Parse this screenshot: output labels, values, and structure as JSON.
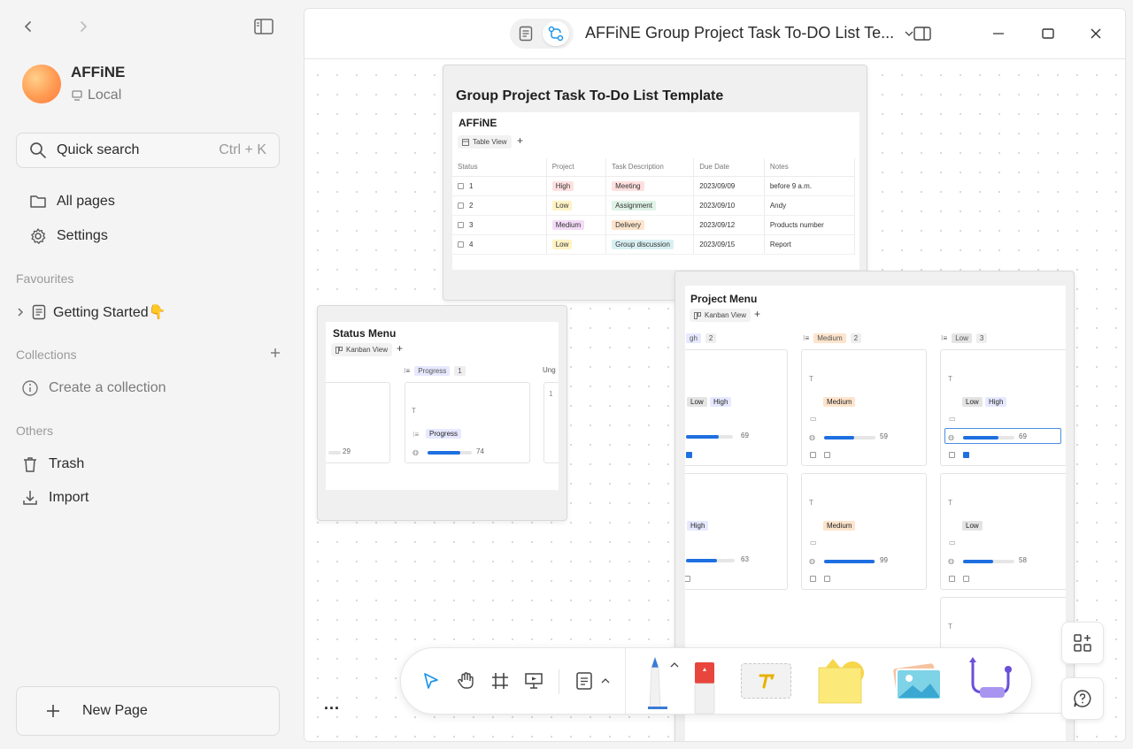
{
  "sidebar": {
    "workspace": {
      "name": "AFFiNE",
      "type": "Local"
    },
    "search": {
      "label": "Quick search",
      "shortcut": "Ctrl + K"
    },
    "nav": {
      "all_pages": "All pages",
      "settings": "Settings"
    },
    "favourites": {
      "title": "Favourites",
      "items": [
        {
          "label": "Getting Started👇"
        }
      ]
    },
    "collections": {
      "title": "Collections",
      "create_label": "Create a collection"
    },
    "others": {
      "title": "Others",
      "trash": "Trash",
      "import": "Import"
    },
    "new_page": "New Page"
  },
  "titlebar": {
    "title": "AFFiNE Group Project Task To-DO List Te..."
  },
  "canvas": {
    "main_card": {
      "title": "Group Project Task To-Do List Template",
      "db_title": "AFFiNE",
      "view": "Table View",
      "columns": [
        "Status",
        "Project",
        "Task Description",
        "Due Date",
        "Notes"
      ],
      "rows": [
        {
          "status": "1",
          "project": "High",
          "task": "Meeting",
          "due": "2023/09/09",
          "notes": "before 9 a.m."
        },
        {
          "status": "2",
          "project": "Low",
          "task": "Assignment",
          "due": "2023/09/10",
          "notes": "Andy"
        },
        {
          "status": "3",
          "project": "Medium",
          "task": "Delivery",
          "due": "2023/09/12",
          "notes": "Products number"
        },
        {
          "status": "4",
          "project": "Low",
          "task": "Group discussion",
          "due": "2023/09/15",
          "notes": "Report"
        }
      ]
    },
    "status_card": {
      "title": "Status Menu",
      "view": "Kanban View",
      "column_progress": {
        "label": "Progress",
        "count": "1"
      },
      "column_cut": "Ung",
      "left_value": 29,
      "card": {
        "tag": "Progress",
        "progress": 74
      }
    },
    "project_card": {
      "title": "Project Menu",
      "view": "Kanban View",
      "columns": [
        {
          "label": "gh",
          "count": "2"
        },
        {
          "label": "Medium",
          "count": "2"
        },
        {
          "label": "Low",
          "count": "3"
        }
      ],
      "cards": [
        {
          "tags": [
            "Low",
            "High"
          ],
          "progress": 69,
          "checked": true
        },
        {
          "tags": [
            "Medium"
          ],
          "progress": 59,
          "checked": false
        },
        {
          "tags": [
            "Low",
            "High"
          ],
          "progress": 69,
          "checked": true
        },
        {
          "tags": [
            "High"
          ],
          "progress": 63,
          "checked": false
        },
        {
          "tags": [
            "Medium"
          ],
          "progress": 99,
          "checked": false
        },
        {
          "tags": [
            "Low"
          ],
          "progress": 58,
          "checked": false
        }
      ]
    },
    "more_label": "..."
  },
  "colors": {
    "accent": "#1e6fe0",
    "tag_high": "#fde0df",
    "tag_low": "#fff3c4",
    "tag_medium": "#f3dcf7",
    "tag_meeting": "#fde0df",
    "tag_assignment": "#dff3e6",
    "tag_delivery": "#fde4cc",
    "tag_discussion": "#d9f0f3"
  },
  "icons": [
    "chevron-left-icon",
    "chevron-right-icon",
    "sidebar-toggle-icon",
    "search-icon",
    "folder-icon",
    "gear-icon",
    "page-icon",
    "info-icon",
    "trash-icon",
    "import-icon",
    "plus-icon",
    "pointer-icon",
    "hand-icon",
    "frame-icon",
    "present-icon",
    "note-icon",
    "pen-icon",
    "eraser-icon",
    "text-icon",
    "sticky-note-icon",
    "image-icon",
    "connector-icon",
    "add-grid-icon",
    "help-icon"
  ]
}
